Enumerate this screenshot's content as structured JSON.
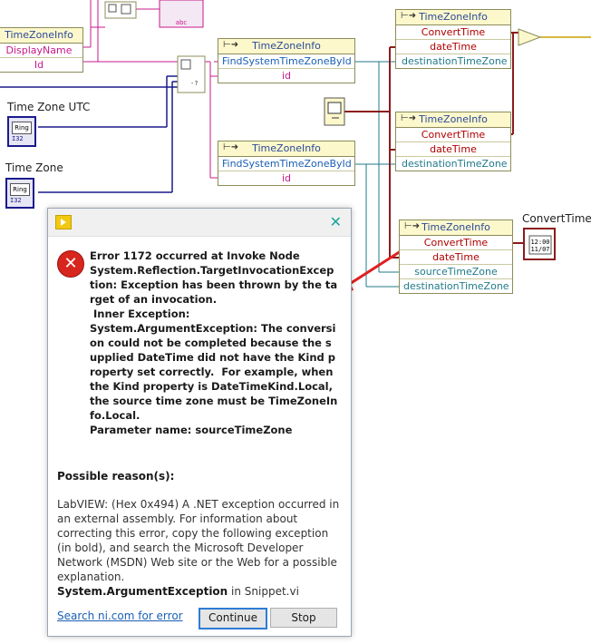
{
  "diagram": {
    "nodes": {
      "tzinfo_topleft": {
        "title": "TimeZoneInfo",
        "rows": [
          "DisplayName",
          "Id"
        ]
      },
      "find1": {
        "title": "TimeZoneInfo",
        "rows": [
          "FindSystemTimeZoneById",
          "id"
        ]
      },
      "find2": {
        "title": "TimeZoneInfo",
        "rows": [
          "FindSystemTimeZoneById",
          "id"
        ]
      },
      "convert1": {
        "title": "TimeZoneInfo",
        "rows": [
          "ConvertTime",
          "dateTime",
          "destinationTimeZone"
        ]
      },
      "convert2": {
        "title": "TimeZoneInfo",
        "rows": [
          "ConvertTime",
          "dateTime",
          "destinationTimeZone"
        ]
      },
      "convert3": {
        "title": "TimeZoneInfo",
        "rows": [
          "ConvertTime",
          "dateTime",
          "sourceTimeZone",
          "destinationTimeZone"
        ]
      }
    },
    "controls": {
      "tz_utc_label": "Time Zone UTC",
      "tz_label": "Time Zone",
      "ring_text": "Ring",
      "ring_type": "I32",
      "convert_time_label": "ConvertTime",
      "clock_text": "12:00",
      "clock_date": "11/07",
      "cluster_text": "abc"
    }
  },
  "dialog": {
    "error_message": "Error 1172 occurred at Invoke Node\nSystem.Reflection.TargetInvocationException: Exception has been thrown by the target of an invocation.\n Inner Exception:\nSystem.ArgumentException: The conversion could not be completed because the supplied DateTime did not have the Kind property set correctly.  For example, when the Kind property is DateTimeKind.Local, the source time zone must be TimeZoneInfo.Local.\nParameter name: sourceTimeZone",
    "reason_heading": "Possible reason(s):",
    "reason_text": "LabVIEW:  (Hex 0x494) A .NET exception occurred in an external assembly. For information about correcting this error, copy the following exception (in bold), and search the Microsoft Developer Network (MSDN) Web site or the Web for a possible explanation.",
    "reason_exception": "System.ArgumentException",
    "reason_suffix": " in Snippet.vi",
    "search_link": "Search ni.com for error",
    "continue_label": "Continue",
    "stop_label": "Stop",
    "close_glyph": "✕"
  },
  "colors": {
    "wire_blue": "#1a1a8c",
    "wire_pink": "#c8188c",
    "wire_teal": "#1f7a8a",
    "wire_red": "#8b1c1c",
    "wire_gold": "#c8a000",
    "arrow": "#e02020"
  }
}
